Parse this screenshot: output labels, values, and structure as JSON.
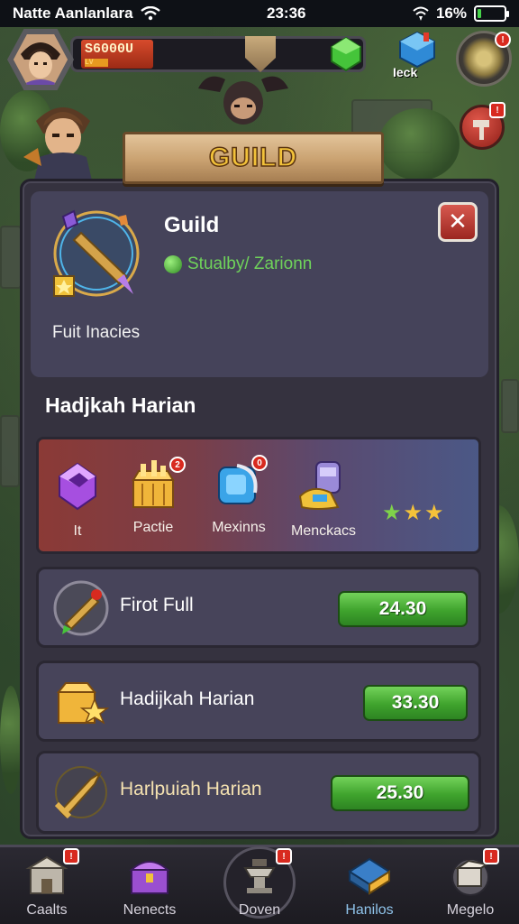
{
  "status_bar": {
    "carrier": "Natte Aanlanlara",
    "time": "23:36",
    "battery": "16%",
    "battery_level": 0.16
  },
  "hud": {
    "player_name": "S6000U",
    "player_sub": "LV",
    "currency_label": "Ieck"
  },
  "title_banner": "GUILD",
  "guild": {
    "title": "Guild",
    "status": "Stualby/ Zarionn",
    "subtitle": "Fuit Inacies"
  },
  "section_title": "Hadjkah Harian",
  "rewards": [
    {
      "label": "It",
      "icon": "purple-crystal-icon"
    },
    {
      "label": "Pactie",
      "icon": "gold-chest-icon",
      "badge": "2"
    },
    {
      "label": "Mexinns",
      "icon": "blue-gem-icon",
      "badge": "0"
    },
    {
      "label": "Menckacs",
      "icon": "potion-bottle-icon"
    }
  ],
  "reward_stars": 3,
  "list_items": [
    {
      "label": "Firot Full",
      "price": "24.30",
      "icon": "golden-sword-icon"
    },
    {
      "label": "Hadijkah Harian",
      "price": "33.30",
      "icon": "golden-star-chest-icon"
    },
    {
      "label": "Harlpuiah Harian",
      "price": "25.30",
      "icon": "golden-blade-icon"
    }
  ],
  "bottom_nav": [
    {
      "label": "Caalts",
      "icon": "castle-icon",
      "badge": "!"
    },
    {
      "label": "Nenects",
      "icon": "purple-chest-icon"
    },
    {
      "label": "Doven",
      "icon": "anvil-icon",
      "badge": "!"
    },
    {
      "label": "Hanilos",
      "icon": "blue-book-icon",
      "active": true
    },
    {
      "label": "Megelo",
      "icon": "gear-box-icon",
      "badge": "!"
    }
  ],
  "colors": {
    "panel": "#35323f",
    "price_button": "#3fa32d",
    "banner_text": "#f2c23a",
    "status_green": "#6fd35a"
  }
}
